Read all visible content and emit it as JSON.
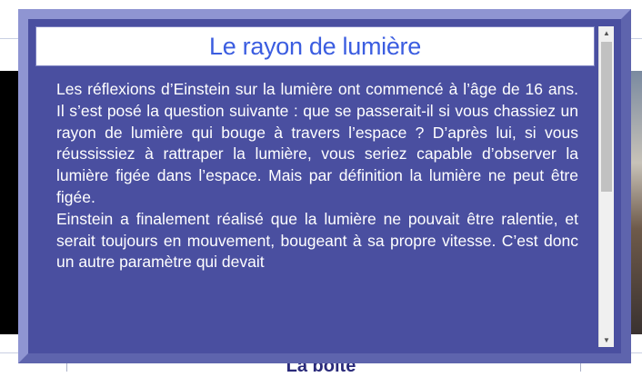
{
  "modal": {
    "title": "Le rayon de lumière",
    "paragraphs": [
      "Les réflexions d’Einstein sur la lumière ont commencé à l’âge de 16 ans. Il s’est posé la question suivante : que se passerait-il si vous chassiez un rayon de lumière qui bouge à travers l’espace ? D’après lui, si vous réussissiez à rattraper la lumière, vous seriez capable d’observer la lumière figée dans l’espace. Mais par définition la lumière ne peut être figée.",
      "Einstein a finalement réalisé que la lumière ne pouvait être ralentie, et serait toujours en mouvement, bougeant à sa propre vitesse. C’est donc un autre paramètre qui devait"
    ],
    "scrollbar": {
      "up_arrow": "▲",
      "down_arrow": "▼"
    }
  },
  "background": {
    "bottom_title": "La boîte"
  },
  "colors": {
    "modal_background": "#4a4fa0",
    "frame_light": "#8f95d2",
    "frame_dark": "#5e64ad",
    "title_text": "#3b5de0"
  }
}
